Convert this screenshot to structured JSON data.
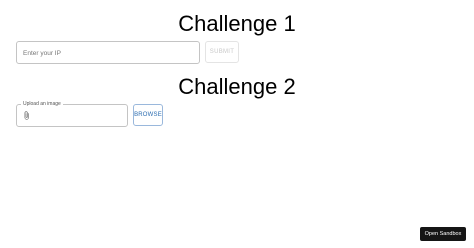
{
  "challenge1": {
    "title": "Challenge 1",
    "ip_input": {
      "value": "",
      "placeholder": "Enter your IP"
    },
    "submit_label": "SUBMIT"
  },
  "challenge2": {
    "title": "Challenge 2",
    "upload_label": "Upload an image",
    "upload_icon": "paperclip-icon",
    "browse_label": "BROWSE"
  },
  "sandbox": {
    "label": "Open Sandbox"
  },
  "colors": {
    "browse_accent": "#2b6cb0",
    "sandbox_bg": "#151515",
    "disabled_text": "#c8c8c8"
  }
}
